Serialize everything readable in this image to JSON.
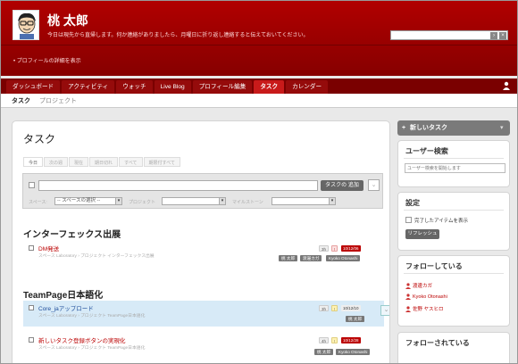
{
  "header": {
    "user_name": "桃 太郎",
    "status_message": "今日は現先から直帰します。何か連絡がありましたら、月曜日に折り返し連絡すると伝えておいてください。",
    "profile_link": "• プロフィールの詳細を表示",
    "search": {
      "value": "",
      "placeholder": ""
    }
  },
  "nav": {
    "tabs": [
      {
        "label": "ダッシュボード"
      },
      {
        "label": "アクティビティ"
      },
      {
        "label": "ウォッチ"
      },
      {
        "label": "Live Blog"
      },
      {
        "label": "プロフィール編集"
      },
      {
        "label": "タスク",
        "active": true
      },
      {
        "label": "カレンダー"
      }
    ]
  },
  "subnav": {
    "items": [
      "タスク",
      "プロジェクト"
    ]
  },
  "main": {
    "title": "タスク",
    "filter_tabs": [
      "今日",
      "次の週",
      "現在",
      "期日切れ",
      "すべて",
      "期限付すべて"
    ],
    "add_task": {
      "input_value": "",
      "button_label": "タスクの 追加",
      "space_label": "スペース:",
      "space_value": "-- スペースの選択 --",
      "project_label": "プロジェクト",
      "milestone_label": "マイルストーン"
    },
    "groups": [
      {
        "title": "インターフェックス出展",
        "tasks": [
          {
            "title": "DM発送",
            "meta": "スペース Laboratory › プロジェクト インターフェックス出展",
            "badge_count": "3h",
            "badge_flag": "!",
            "date": "10/12/06",
            "assignees": [
              "桃 太郎",
              "渡邊カガ",
              "Kyoko Otonashi"
            ]
          }
        ]
      },
      {
        "title": "TeamPage日本語化",
        "tasks": [
          {
            "title": "Core_jaアップロード",
            "meta": "スペース Laboratory › プロジェクト TeamPage日本語化",
            "badge_count": "3h",
            "badge_flag": "!",
            "date": "10/12/10",
            "assignees": [
              "桃 太郎"
            ]
          },
          {
            "title": "新しいタスク登録ボタンの実現化",
            "meta": "スペース Laboratory › プロジェクト TeamPage日本語化",
            "badge_count": "4h",
            "badge_flag": "!",
            "date": "10/12/28",
            "assignees": [
              "桃 太郎",
              "Kyoko Otonashi"
            ]
          }
        ]
      }
    ]
  },
  "sidebar": {
    "new_task_label": "新しいタスク",
    "user_search": {
      "title": "ユーザー検索",
      "placeholder": "ユーザー検索を開始します"
    },
    "settings": {
      "title": "設定",
      "show_completed_label": "完了したアイテムを表示",
      "refresh_label": "リフレッシュ"
    },
    "following": {
      "title": "フォローしている",
      "users": [
        "渡邊カガ",
        "Kyoko Otonashi",
        "佐野 ヤスヒロ"
      ]
    },
    "followed_by": {
      "title": "フォローされている"
    }
  },
  "colors": {
    "brand_red": "#a60000",
    "link_red": "#bb0000",
    "link_blue": "#1d4c9a"
  }
}
